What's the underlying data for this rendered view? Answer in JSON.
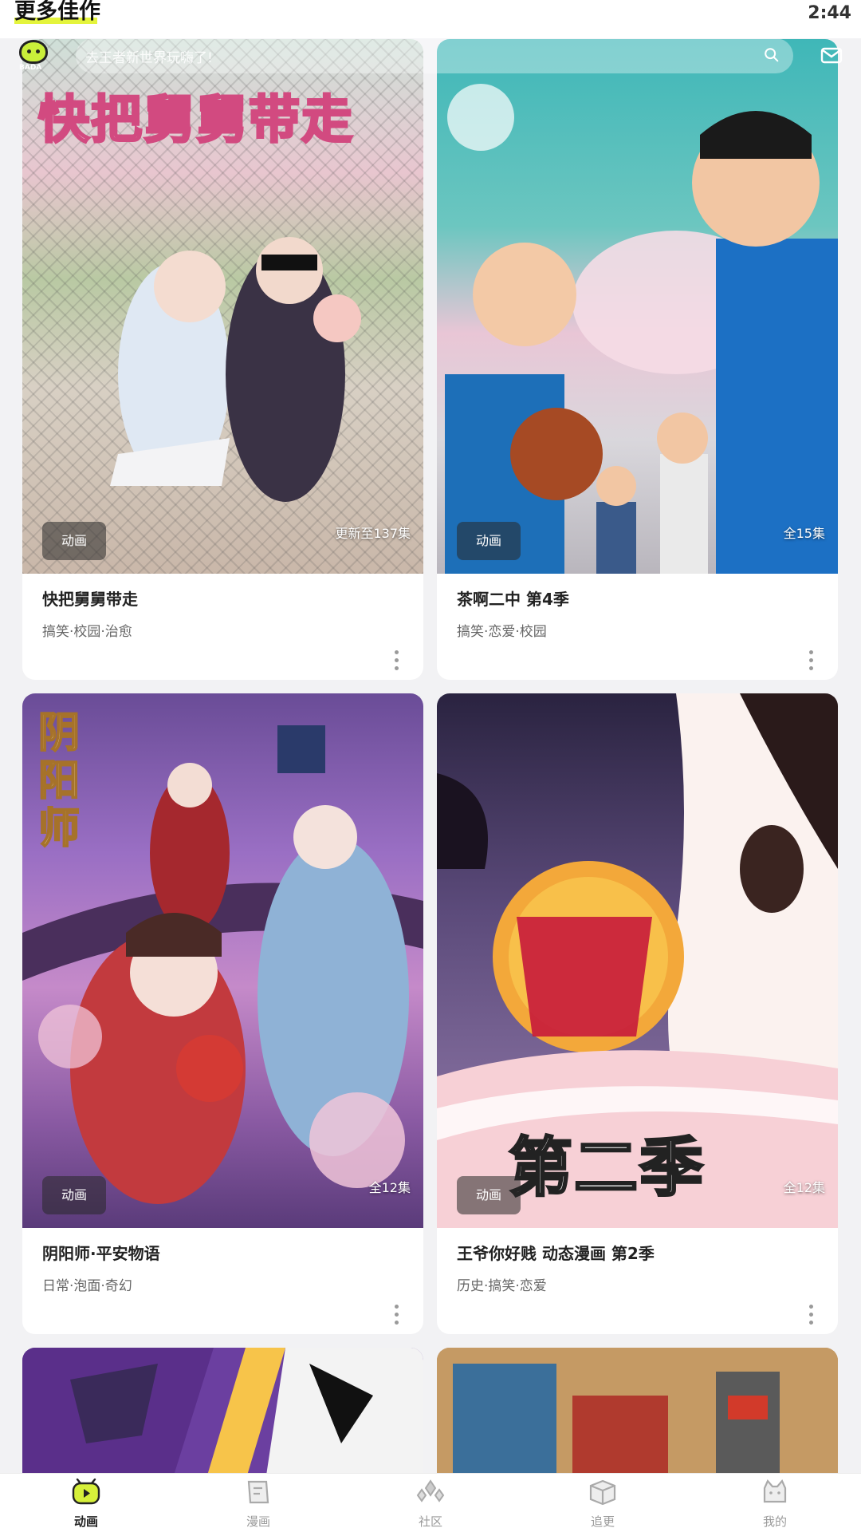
{
  "header": {
    "section_title": "更多佳作",
    "time": "2:44",
    "search_placeholder": "去王者新世界玩嗨了!",
    "logo_text": "BADA"
  },
  "cards": [
    {
      "title": "快把舅舅带走",
      "tags": "搞笑·校园·治愈",
      "badge": "动画",
      "episodes": "更新至137集",
      "cover_text": "快把舅舅带走"
    },
    {
      "title": "茶啊二中 第4季",
      "tags": "搞笑·恋爱·校园",
      "badge": "动画",
      "episodes": "全15集",
      "cover_text": ""
    },
    {
      "title": "阴阳师·平安物语",
      "tags": "日常·泡面·奇幻",
      "badge": "动画",
      "episodes": "全12集",
      "cover_text": "阴阳师"
    },
    {
      "title": "王爷你好贱 动态漫画 第2季",
      "tags": "历史·搞笑·恋爱",
      "badge": "动画",
      "episodes": "全12集",
      "cover_text": "第二季"
    }
  ],
  "nav": {
    "items": [
      {
        "label": "动画",
        "icon": "tv-icon",
        "active": true
      },
      {
        "label": "漫画",
        "icon": "comic-icon",
        "active": false
      },
      {
        "label": "社区",
        "icon": "community-icon",
        "active": false
      },
      {
        "label": "追更",
        "icon": "follow-icon",
        "active": false
      },
      {
        "label": "我的",
        "icon": "profile-icon",
        "active": false
      }
    ]
  },
  "colors": {
    "accent": "#d6f03a",
    "background": "#f2f2f4",
    "card": "#ffffff"
  }
}
